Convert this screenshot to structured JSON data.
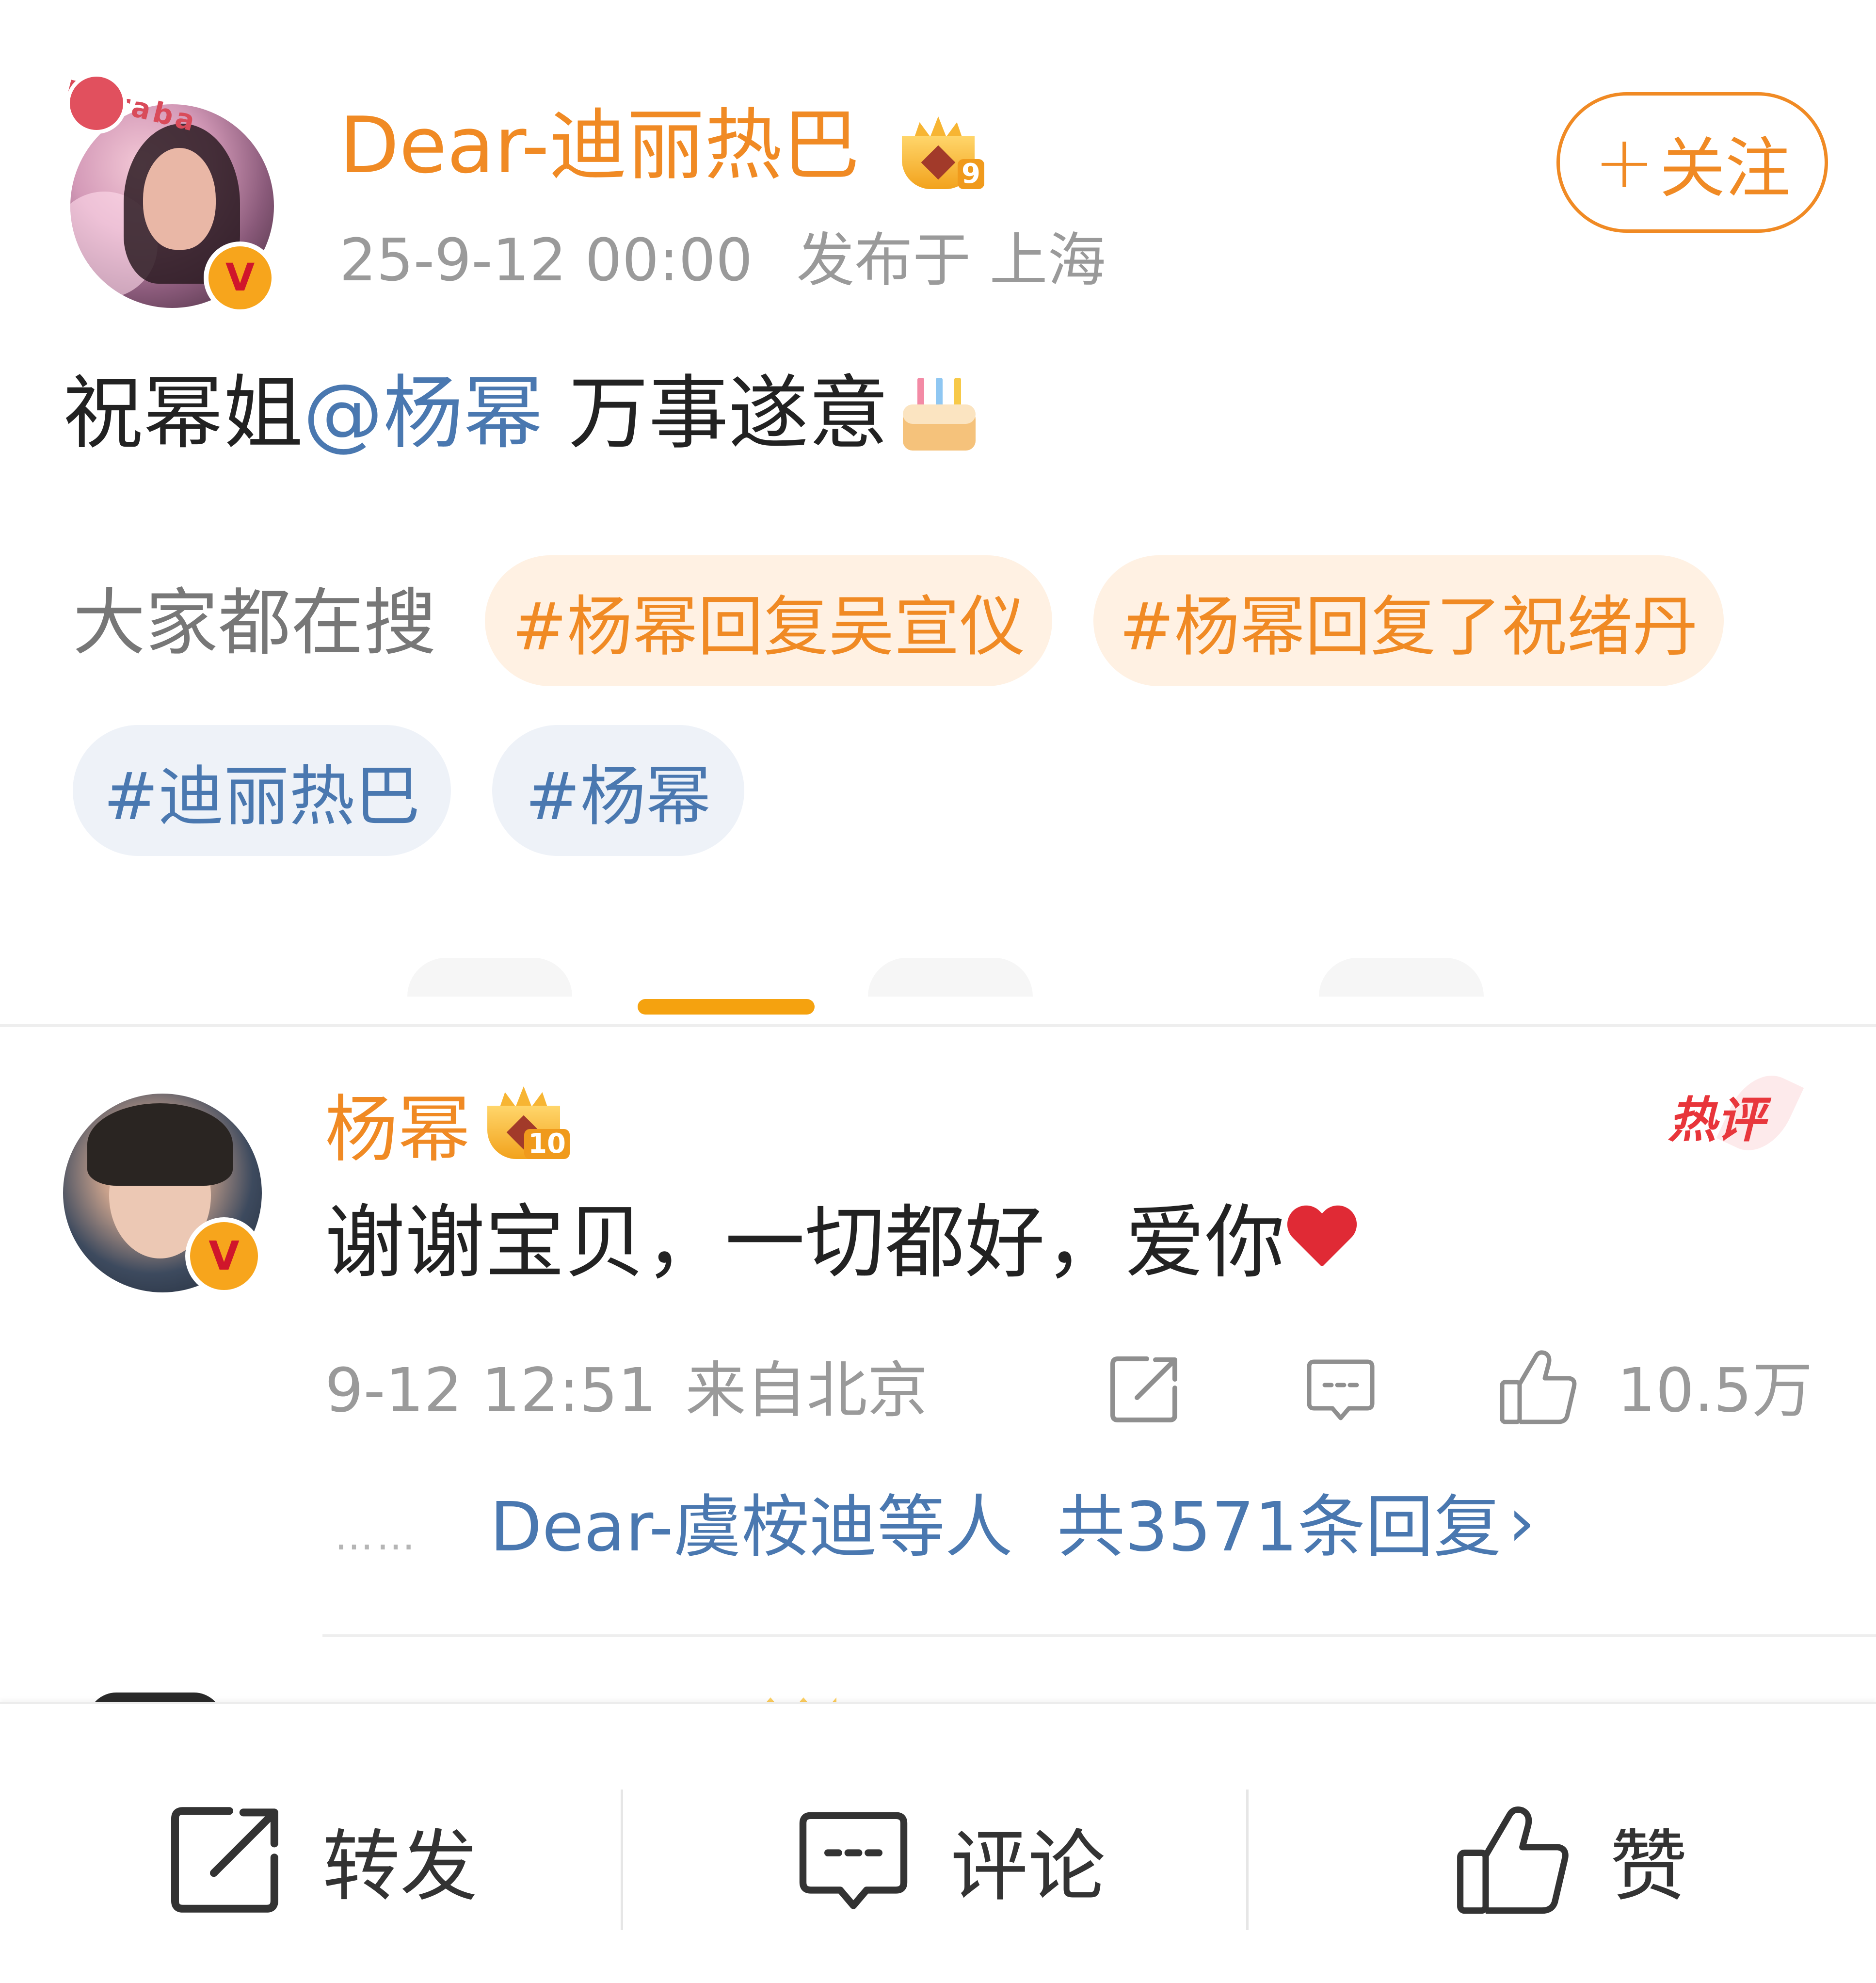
{
  "post": {
    "author_name": "Dear-迪丽热巴",
    "author_level": "9",
    "avatar_decoration_text": "Dilraba",
    "verified_mark": "V",
    "time": "25-9-12 00:00",
    "location": "发布于 上海",
    "follow_label": "关注",
    "follow_plus": "+",
    "text_prefix": "祝幂姐",
    "mention": "@杨幂",
    "text_suffix": " 万事遂意",
    "emoji": "cake"
  },
  "search": {
    "label": "大家都在搜",
    "tags": [
      "#杨幂回复吴宣仪",
      "#杨幂回复了祝绪丹",
      "#迪丽热巴",
      "#杨幂"
    ]
  },
  "comment": {
    "author_name": "杨幂",
    "author_level": "10",
    "verified_mark": "V",
    "hot_badge": "热评",
    "text": "谢谢宝贝，一切都好，爱你",
    "emoji": "red-heart",
    "time": "9-12 12:51",
    "location": "来自北京",
    "likes": "10.5万",
    "reply_dots": "……",
    "reply_users": "Dear-虞桉迪等人",
    "reply_total": "共3571条回复",
    "reply_chevron": "›"
  },
  "bottom_bar": {
    "repost_label": "转发",
    "comment_label": "评论",
    "like_label": "赞"
  },
  "colors": {
    "accent_orange": "#f08a24",
    "link_blue": "#4a78b0",
    "hot_red": "#e8353a",
    "meta_gray": "#9a9a9a",
    "tab_indicator": "#f5a20f"
  },
  "icons": [
    "crown-level-icon",
    "verified-v-icon",
    "cake-emoji-icon",
    "heart-emoji-icon",
    "repost-icon",
    "comment-icon",
    "like-icon"
  ]
}
